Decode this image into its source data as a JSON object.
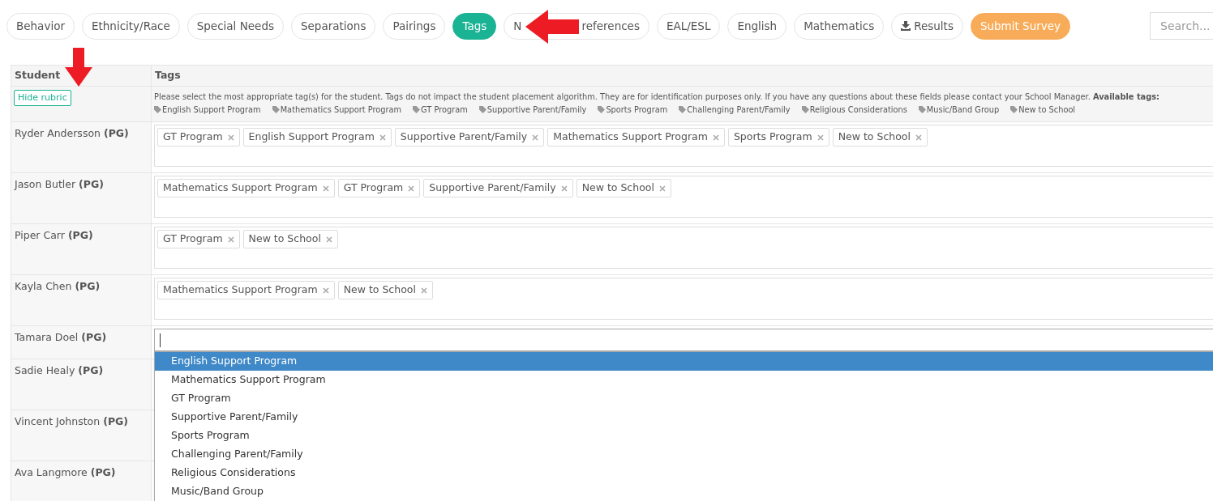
{
  "tabs": [
    {
      "kind": "tab",
      "label": "Behavior",
      "selected": false
    },
    {
      "kind": "tab",
      "label": "Ethnicity/Race",
      "selected": false
    },
    {
      "kind": "tab",
      "label": "Special Needs",
      "selected": false
    },
    {
      "kind": "tab",
      "label": "Separations",
      "selected": false
    },
    {
      "kind": "tab",
      "label": "Pairings",
      "selected": false
    },
    {
      "kind": "tab",
      "label": "Tags",
      "selected": true
    },
    {
      "kind": "covered",
      "label": "N",
      "label_tail": "references",
      "selected": false
    },
    {
      "kind": "tab",
      "label": "EAL/ESL",
      "selected": false
    },
    {
      "kind": "tab",
      "label": "English",
      "selected": false
    },
    {
      "kind": "tab",
      "label": "Mathematics",
      "selected": false
    },
    {
      "kind": "download",
      "label": "Results",
      "selected": false
    },
    {
      "kind": "submit",
      "label": "Submit Survey",
      "selected": false
    }
  ],
  "search": {
    "placeholder": "Search..."
  },
  "table": {
    "columns": [
      "Student",
      "Tags"
    ],
    "rubric": {
      "button": "Hide rubric",
      "text": "Please select the most appropriate tag(s) for the student. Tags do not impact the student placement algorithm. They are for identification purposes only. If you have any questions about these fields please contact your School Manager. **Available tags:**",
      "available_tags": [
        "English Support Program",
        "Mathematics Support Program",
        "GT Program",
        "Supportive Parent/Family",
        "Sports Program",
        "Challenging Parent/Family",
        "Religious Considerations",
        "Music/Band Group",
        "New to School"
      ]
    },
    "rows": [
      {
        "name": "Ryder Andersson",
        "badge": "(PG)",
        "focused": false,
        "tags": [
          "GT Program",
          "English Support Program",
          "Supportive Parent/Family",
          "Mathematics Support Program",
          "Sports Program",
          "New to School"
        ]
      },
      {
        "name": "Jason Butler",
        "badge": "(PG)",
        "focused": false,
        "tags": [
          "Mathematics Support Program",
          "GT Program",
          "Supportive Parent/Family",
          "New to School"
        ]
      },
      {
        "name": "Piper Carr",
        "badge": "(PG)",
        "focused": false,
        "tags": [
          "GT Program",
          "New to School"
        ]
      },
      {
        "name": "Kayla Chen",
        "badge": "(PG)",
        "focused": false,
        "tags": [
          "Mathematics Support Program",
          "New to School"
        ]
      },
      {
        "name": "Tamara Doel",
        "badge": "(PG)",
        "focused": true,
        "tags": []
      },
      {
        "name": "Sadie Healy",
        "badge": "(PG)",
        "focused": false,
        "tags": []
      },
      {
        "name": "Vincent Johnston",
        "badge": "(PG)",
        "focused": false,
        "tags": []
      },
      {
        "name": "Ava Langmore",
        "badge": "(PG)",
        "focused": false,
        "tags": []
      }
    ],
    "dropdown": {
      "options": [
        {
          "label": "English Support Program",
          "selected": true
        },
        {
          "label": "Mathematics Support Program",
          "selected": false
        },
        {
          "label": "GT Program",
          "selected": false
        },
        {
          "label": "Supportive Parent/Family",
          "selected": false
        },
        {
          "label": "Sports Program",
          "selected": false
        },
        {
          "label": "Challenging Parent/Family",
          "selected": false
        },
        {
          "label": "Religious Considerations",
          "selected": false
        },
        {
          "label": "Music/Band Group",
          "selected": false
        }
      ]
    }
  }
}
